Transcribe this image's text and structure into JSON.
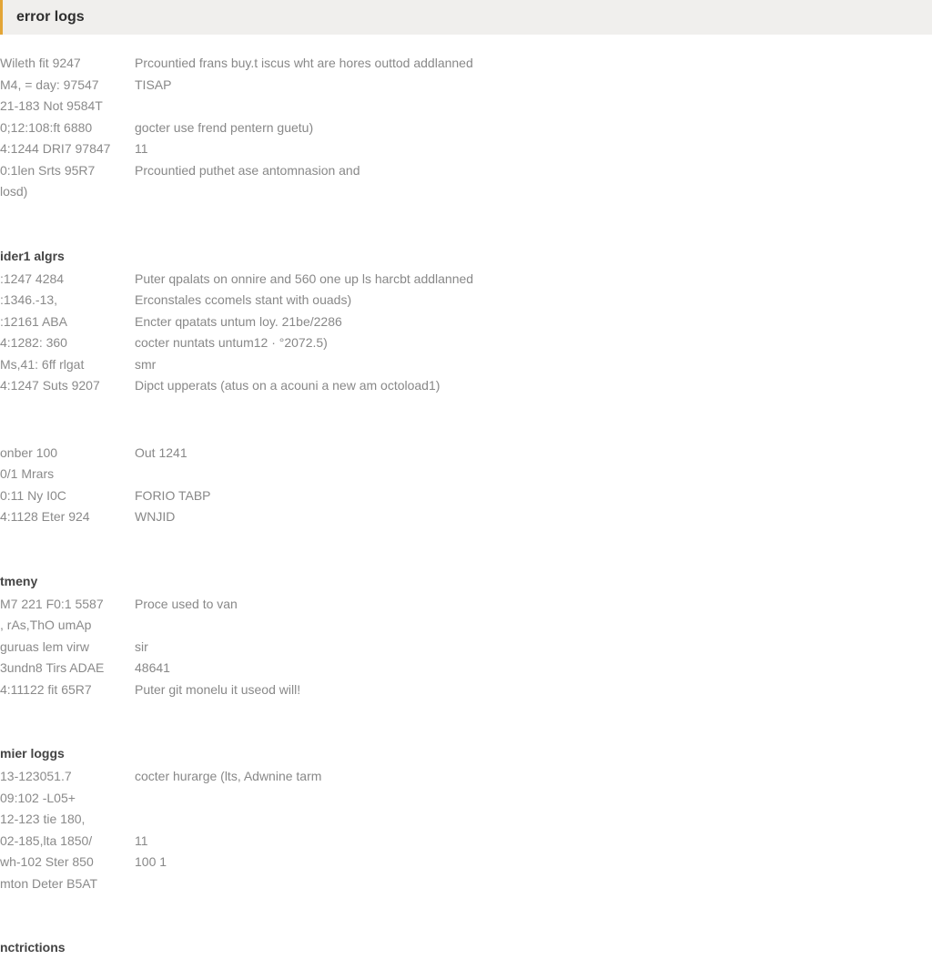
{
  "header": {
    "title": "error logs"
  },
  "sections": [
    {
      "heading": null,
      "rows": [
        {
          "meta": "Wileth fit 9247",
          "msg": "Prcountied frans buy.t iscus wht are hores  outtod addlanned"
        },
        {
          "meta": "M4, = day: 97547",
          "msg": "TISAP"
        },
        {
          "meta": "21-183 Not 9584T",
          "msg": ""
        },
        {
          "meta": "0;12:108:ft 6880",
          "msg": "gocter use frend pentern guetu)"
        },
        {
          "meta": "4:1244 DRI7 97847",
          "msg": "11"
        },
        {
          "meta": "0:1len Srts 95R7",
          "msg": "Prcountied puthet ase antomnasion and"
        },
        {
          "meta": "losd)",
          "msg": ""
        }
      ]
    },
    {
      "heading": "ider1 algrs",
      "rows": [
        {
          "meta": ":1247 4284",
          "msg": "Puter qpalats on onnire and 560 one up ls  harcbt addlanned"
        },
        {
          "meta": ":1346.-13,",
          "msg": "Erconstales ccomels stant with ouads)"
        },
        {
          "meta": ":12161 ABA",
          "msg": "Encter qpatats untum loy. 21be/2286"
        },
        {
          "meta": "4:1282: 360",
          "msg": "cocter nuntats untum12 · °2072.5)"
        },
        {
          "meta": "Ms,41: 6ff rlgat",
          "msg": "smr"
        },
        {
          "meta": "4:1247 Suts 9207",
          "msg": "Dipct upperats (atus on a acouni a new am octoload1)"
        }
      ]
    },
    {
      "heading": null,
      "rows": [
        {
          "meta": "onber 100",
          "msg": "Out 1241"
        },
        {
          "meta": "0/1 Mrars",
          "msg": ""
        },
        {
          "meta": "0:11 Ny I0C",
          "msg": "FORIO TABP"
        },
        {
          "meta": "4:1128 Eter 924",
          "msg": "WNJID"
        }
      ]
    },
    {
      "heading": "tmeny",
      "rows": [
        {
          "meta": "M7 221 F0:1 5587",
          "msg": "Proce used to van"
        },
        {
          "meta": ", rAs,ThO umAp",
          "msg": ""
        },
        {
          "meta": "guruas lem virw",
          "msg": "sir"
        },
        {
          "meta": "3undn8 Tirs ADAE",
          "msg": "48641"
        },
        {
          "meta": "4:11122 fit 65R7",
          "msg": "Puter git monelu it useod will!"
        }
      ]
    },
    {
      "heading": "mier loggs",
      "rows": [
        {
          "meta": "13-123051.7",
          "msg": "cocter hurarge (lts, Adwnine tarm"
        },
        {
          "meta": "09:102 -L05+",
          "msg": ""
        },
        {
          "meta": "12-123 tie 180,",
          "msg": ""
        },
        {
          "meta": "02-185,lta 1850/",
          "msg": "11"
        },
        {
          "meta": "wh-102 Ster 850",
          "msg": "100 1"
        },
        {
          "meta": "mton Deter B5AT",
          "msg": ""
        }
      ]
    },
    {
      "heading": "nctrictions",
      "rows": []
    }
  ]
}
